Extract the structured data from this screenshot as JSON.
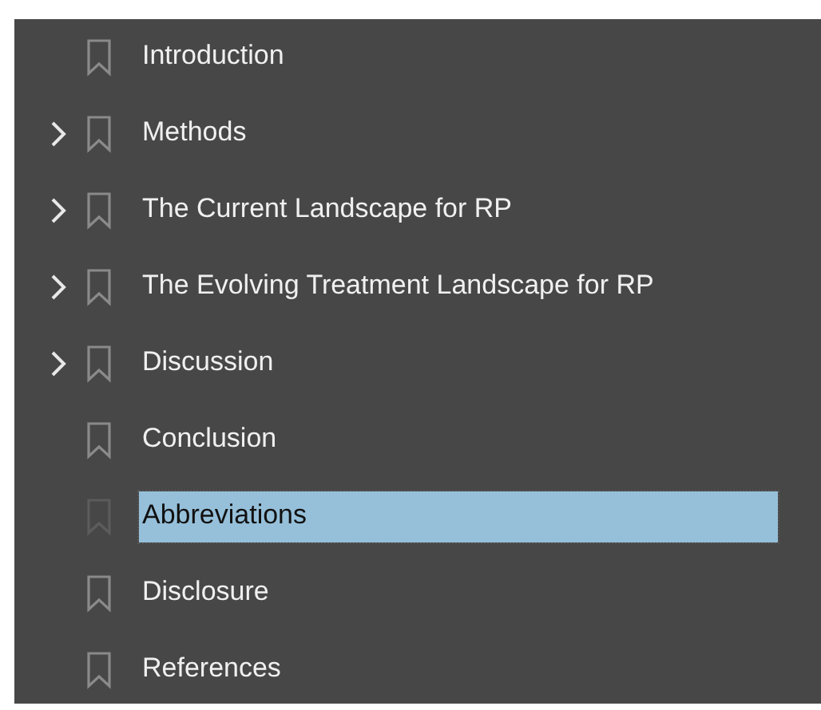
{
  "bookmarks": [
    {
      "label": "Introduction",
      "kind": "leaf",
      "selected": false
    },
    {
      "label": "Methods",
      "kind": "branch",
      "expanded": false,
      "selected": false
    },
    {
      "label": "The Current Landscape for RP",
      "kind": "branch",
      "expanded": false,
      "selected": false
    },
    {
      "label": "The Evolving Treatment Landscape for RP",
      "kind": "branch",
      "expanded": false,
      "selected": false
    },
    {
      "label": "Discussion",
      "kind": "branch",
      "expanded": false,
      "selected": false
    },
    {
      "label": "Conclusion",
      "kind": "leaf",
      "selected": false
    },
    {
      "label": "Abbreviations",
      "kind": "leaf",
      "selected": true
    },
    {
      "label": "Disclosure",
      "kind": "leaf",
      "selected": false
    },
    {
      "label": "References",
      "kind": "leaf",
      "selected": false
    }
  ]
}
